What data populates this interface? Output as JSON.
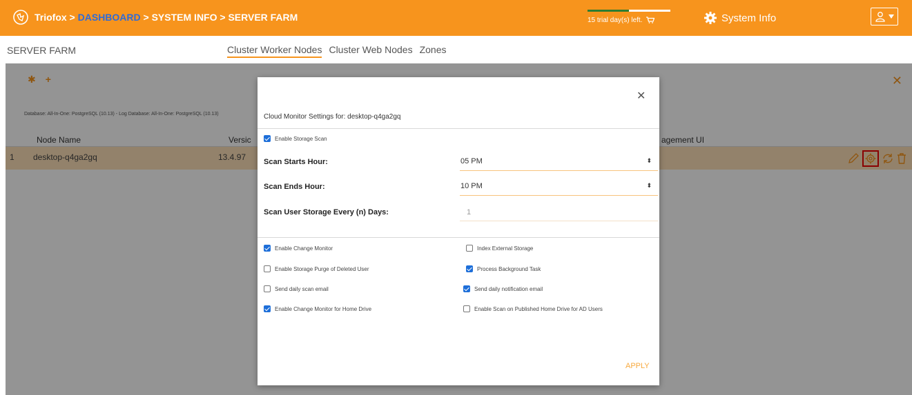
{
  "header": {
    "brand": "Triofox",
    "sep1": " > ",
    "crumb_dashboard": "DASHBOARD",
    "crumb_rest": " > SYSTEM INFO > SERVER FARM",
    "trial_text": "15 trial day(s) left.",
    "trial_progress": 0.5,
    "system_info": "System Info"
  },
  "subheader": {
    "title": "SERVER FARM",
    "tabs": [
      "Cluster Worker Nodes",
      "Cluster Web Nodes",
      "Zones"
    ],
    "active_tab": "Cluster Worker Nodes"
  },
  "page": {
    "db_info": "Database: All-In-One: PostgreSQL (10.13) - Log Database: All-In-One: PostgreSQL (10.13)",
    "columns": {
      "node_name": "Node Name",
      "version": "Versic",
      "mgmt": "agement UI"
    },
    "rows": [
      {
        "index": "1",
        "node": "desktop-q4ga2gq",
        "version": "13.4.97"
      }
    ]
  },
  "modal": {
    "title": "Cloud Monitor Settings for: desktop-q4ga2gq",
    "enable_storage_scan": "Enable Storage Scan",
    "scan_starts_label": "Scan Starts Hour:",
    "scan_starts_value": "05 PM",
    "scan_ends_label": "Scan Ends Hour:",
    "scan_ends_value": "10 PM",
    "scan_every_label": "Scan User Storage Every (n) Days:",
    "scan_every_value": "1",
    "options": {
      "enable_change_monitor": {
        "label": "Enable Change Monitor",
        "checked": true
      },
      "index_external_storage": {
        "label": "Index External Storage",
        "checked": false
      },
      "enable_storage_purge": {
        "label": "Enable Storage Purge of Deleted User",
        "checked": false
      },
      "process_background_task": {
        "label": "Process Background Task",
        "checked": true
      },
      "send_daily_scan_email": {
        "label": "Send daily scan email",
        "checked": false
      },
      "send_daily_notification_email": {
        "label": "Send daily notification email",
        "checked": true
      },
      "enable_change_monitor_home": {
        "label": "Enable Change Monitor for Home Drive",
        "checked": true
      },
      "enable_scan_published_home": {
        "label": "Enable Scan on Published Home Drive for AD Users",
        "checked": false
      }
    },
    "apply_label": "APPLY"
  },
  "colors": {
    "accent": "#f7941d",
    "link": "#2f6bd8",
    "checkbox": "#1e6fd9",
    "highlight": "#e00000"
  }
}
